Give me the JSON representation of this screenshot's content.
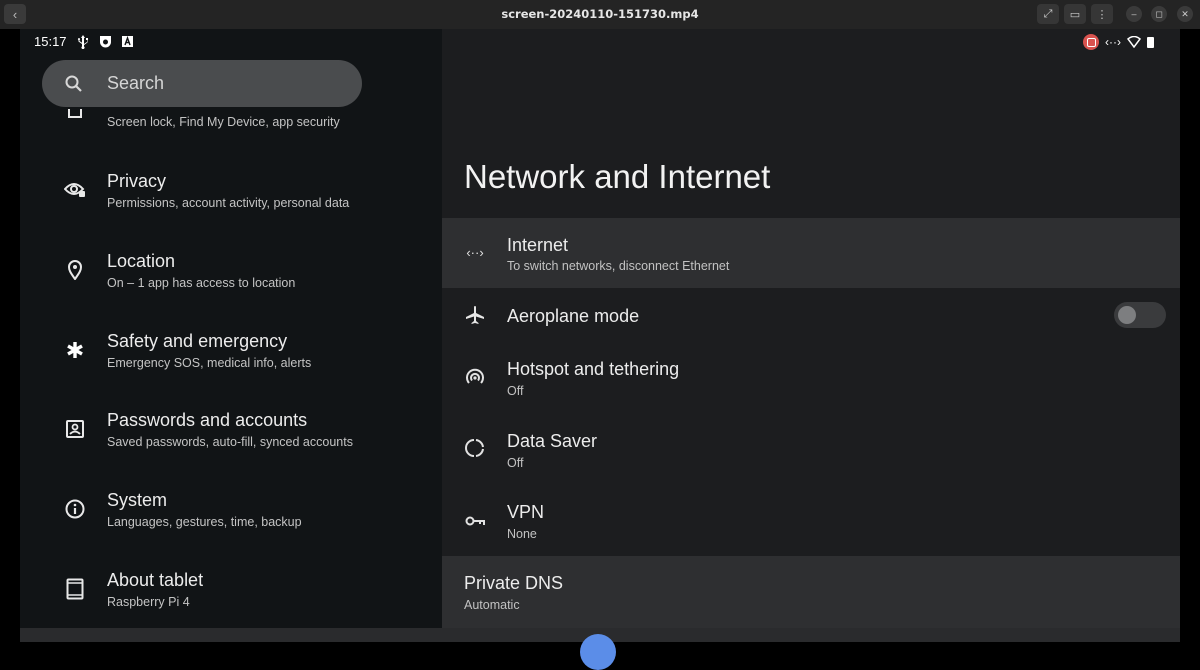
{
  "window": {
    "title": "screen-20240110-151730.mp4",
    "back_label": "‹",
    "buttons": [
      {
        "name": "fullscreen-icon",
        "glyph": "⤢"
      },
      {
        "name": "caption-icon",
        "glyph": "▭"
      },
      {
        "name": "more-vert-icon",
        "glyph": "⋮"
      }
    ],
    "controls": {
      "minimize": "–",
      "restore": "◻",
      "close": "✕"
    }
  },
  "status_bar": {
    "time": "15:17",
    "left_icons": [
      "usb-icon",
      "notification-icon",
      "keyboard-icon"
    ],
    "right_icons": [
      "screen-record-icon",
      "ethernet-icon",
      "wifi-icon",
      "battery-icon"
    ],
    "ethernet_glyph": "‹··›"
  },
  "search": {
    "placeholder": "Search"
  },
  "sidebar": {
    "items": [
      {
        "title": "",
        "subtitle": "Screen lock, Find My Device, app security",
        "icon": "security-icon"
      },
      {
        "title": "Privacy",
        "subtitle": "Permissions, account activity, personal data",
        "icon": "privacy-icon"
      },
      {
        "title": "Location",
        "subtitle": "On – 1 app has access to location",
        "icon": "location-icon"
      },
      {
        "title": "Safety and emergency",
        "subtitle": "Emergency SOS, medical info, alerts",
        "icon": "asterisk-icon"
      },
      {
        "title": "Passwords and accounts",
        "subtitle": "Saved passwords, auto-fill, synced accounts",
        "icon": "account-box-icon"
      },
      {
        "title": "System",
        "subtitle": "Languages, gestures, time, backup",
        "icon": "info-icon"
      },
      {
        "title": "About tablet",
        "subtitle": "Raspberry Pi 4",
        "icon": "tablet-icon"
      }
    ]
  },
  "main": {
    "title": "Network and Internet",
    "items": [
      {
        "title": "Internet",
        "subtitle": "To switch networks, disconnect Ethernet",
        "icon": "ethernet-icon",
        "glyph": "‹··›"
      },
      {
        "title": "Aeroplane mode",
        "subtitle": "",
        "icon": "airplane-icon",
        "toggle": false
      },
      {
        "title": "Hotspot and tethering",
        "subtitle": "Off",
        "icon": "hotspot-icon"
      },
      {
        "title": "Data Saver",
        "subtitle": "Off",
        "icon": "data-saver-icon"
      },
      {
        "title": "VPN",
        "subtitle": "None",
        "icon": "vpn-key-icon"
      },
      {
        "title": "Private DNS",
        "subtitle": "Automatic",
        "icon": ""
      }
    ]
  },
  "colors": {
    "accent": "#5b8de8",
    "record": "#d9534f"
  }
}
